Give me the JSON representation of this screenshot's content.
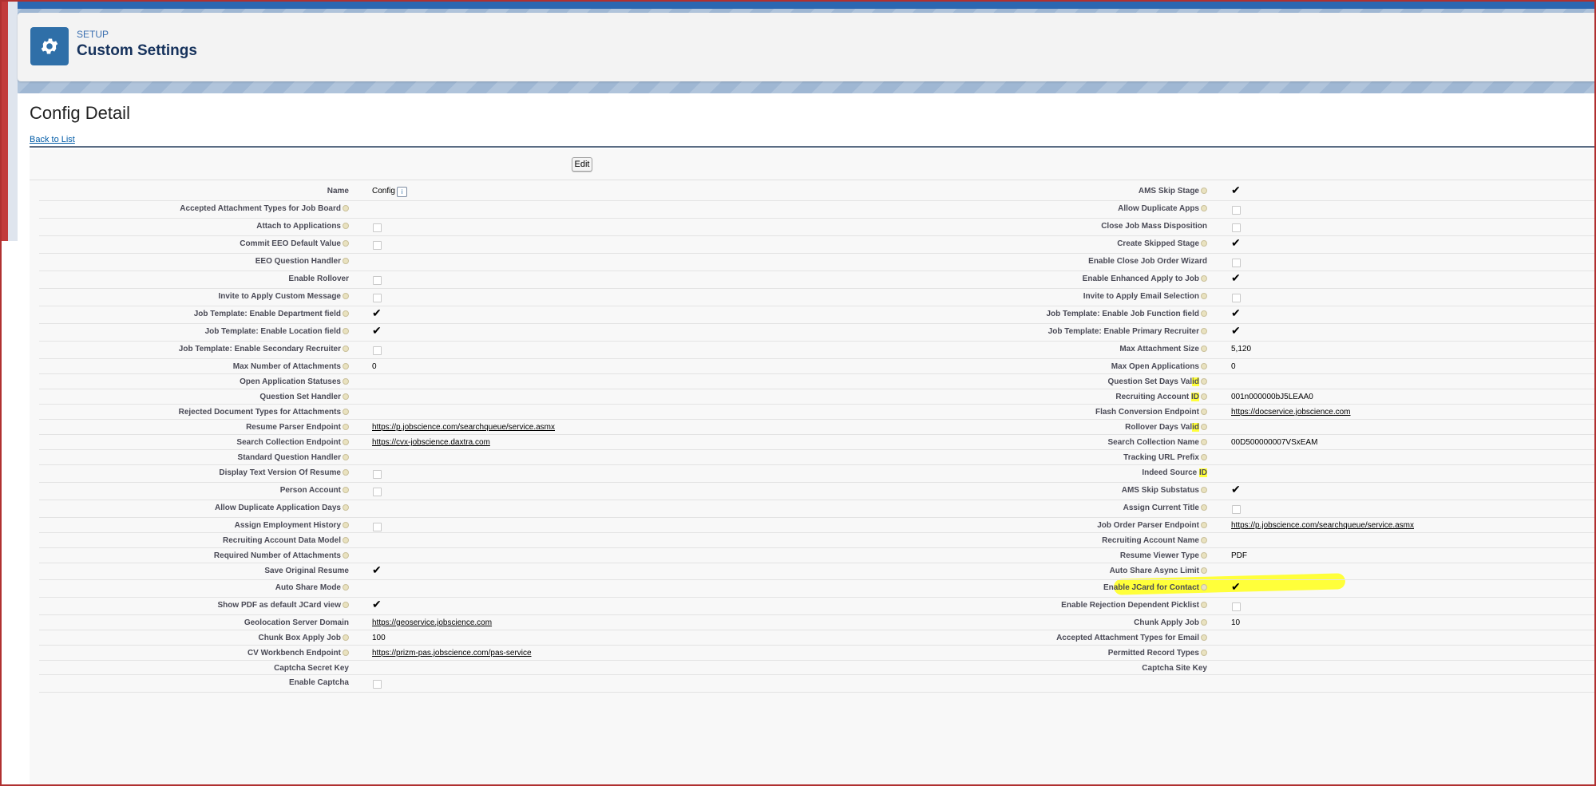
{
  "header": {
    "eyebrow": "SETUP",
    "title": "Custom Settings",
    "icon": "gear-icon"
  },
  "main": {
    "title": "Config Detail",
    "back_link": "Back to List",
    "edit_label": "Edit"
  },
  "colors": {
    "header_bar": "#2b67b1",
    "icon_bg": "#2f6fa8",
    "highlight": "#ffff3a"
  },
  "rows": [
    {
      "left": {
        "label": "Name",
        "type": "text",
        "value": "Config",
        "info": true,
        "help": false
      },
      "right": {
        "label": "AMS Skip Stage",
        "type": "check",
        "checked": true
      }
    },
    {
      "left": {
        "label": "Accepted Attachment Types for Job Board",
        "type": "text",
        "value": ""
      },
      "right": {
        "label": "Allow Duplicate Apps",
        "type": "check",
        "checked": false
      }
    },
    {
      "left": {
        "label": "Attach to Applications",
        "type": "check",
        "checked": false
      },
      "right": {
        "label": "Close Job Mass Disposition",
        "type": "check",
        "checked": false,
        "help": false
      }
    },
    {
      "left": {
        "label": "Commit EEO Default Value",
        "type": "check",
        "checked": false
      },
      "right": {
        "label": "Create Skipped Stage",
        "type": "check",
        "checked": true
      }
    },
    {
      "left": {
        "label": "EEO Question Handler",
        "type": "text",
        "value": ""
      },
      "right": {
        "label": "Enable Close Job Order Wizard",
        "type": "check",
        "checked": false,
        "help": false
      }
    },
    {
      "left": {
        "label": "Enable Rollover",
        "type": "check",
        "checked": false,
        "help": false
      },
      "right": {
        "label": "Enable Enhanced Apply to Job",
        "type": "check",
        "checked": true
      }
    },
    {
      "left": {
        "label": "Invite to Apply Custom Message",
        "type": "check",
        "checked": false
      },
      "right": {
        "label": "Invite to Apply Email Selection",
        "type": "check",
        "checked": false
      }
    },
    {
      "left": {
        "label": "Job Template: Enable Department field",
        "type": "check",
        "checked": true
      },
      "right": {
        "label": "Job Template: Enable Job Function field",
        "type": "check",
        "checked": true
      }
    },
    {
      "left": {
        "label": "Job Template: Enable Location field",
        "type": "check",
        "checked": true
      },
      "right": {
        "label": "Job Template: Enable Primary Recruiter",
        "type": "check",
        "checked": true
      }
    },
    {
      "left": {
        "label": "Job Template: Enable Secondary Recruiter",
        "type": "check",
        "checked": false
      },
      "right": {
        "label": "Max Attachment Size",
        "type": "text",
        "value": "5,120"
      }
    },
    {
      "left": {
        "label": "Max Number of Attachments",
        "type": "text",
        "value": "0"
      },
      "right": {
        "label": "Max Open Applications",
        "type": "text",
        "value": "0"
      }
    },
    {
      "left": {
        "label": "Open Application Statuses",
        "type": "text",
        "value": ""
      },
      "right": {
        "label": "Question Set Days Val",
        "label_hl": "id",
        "type": "text",
        "value": ""
      }
    },
    {
      "left": {
        "label": "Question Set Handler",
        "type": "text",
        "value": ""
      },
      "right": {
        "label": "Recruiting Account ",
        "label_hl": "ID",
        "type": "text",
        "value": "001n000000bJ5LEAA0",
        "highlight": true
      }
    },
    {
      "left": {
        "label": "Rejected Document Types for Attachments",
        "type": "text",
        "value": ""
      },
      "right": {
        "label": "Flash Conversion Endpoint",
        "type": "link",
        "value": "https://docservice.jobscience.com"
      }
    },
    {
      "left": {
        "label": "Resume Parser Endpoint",
        "type": "link",
        "value": "https://p.jobscience.com/searchqueue/service.asmx"
      },
      "right": {
        "label": "Rollover Days Val",
        "label_hl": "id",
        "type": "text",
        "value": ""
      }
    },
    {
      "left": {
        "label": "Search Collection Endpoint",
        "type": "link",
        "value": "https://cvx-jobscience.daxtra.com"
      },
      "right": {
        "label": "Search Collection Name",
        "type": "text",
        "value": "00D500000007VSxEAM"
      }
    },
    {
      "left": {
        "label": "Standard Question Handler",
        "type": "text",
        "value": ""
      },
      "right": {
        "label": "Tracking URL Prefix",
        "type": "text",
        "value": ""
      }
    },
    {
      "left": {
        "label": "Display Text Version Of Resume",
        "type": "check",
        "checked": false
      },
      "right": {
        "label": "Indeed Source ",
        "label_hl": "ID",
        "type": "text",
        "value": "",
        "help": false
      }
    },
    {
      "left": {
        "label": "Person Account",
        "type": "check",
        "checked": false
      },
      "right": {
        "label": "AMS Skip Substatus",
        "type": "check",
        "checked": true
      }
    },
    {
      "left": {
        "label": "Allow Duplicate Application Days",
        "type": "text",
        "value": ""
      },
      "right": {
        "label": "Assign Current Title",
        "type": "check",
        "checked": false
      }
    },
    {
      "left": {
        "label": "Assign Employment History",
        "type": "check",
        "checked": false
      },
      "right": {
        "label": "Job Order Parser Endpoint",
        "type": "link",
        "value": "https://p.jobscience.com/searchqueue/service.asmx"
      }
    },
    {
      "left": {
        "label": "Recruiting Account Data Model",
        "type": "text",
        "value": ""
      },
      "right": {
        "label": "Recruiting Account Name",
        "type": "text",
        "value": ""
      }
    },
    {
      "left": {
        "label": "Required Number of Attachments",
        "type": "text",
        "value": ""
      },
      "right": {
        "label": "Resume Viewer Type",
        "type": "text",
        "value": "PDF"
      }
    },
    {
      "left": {
        "label": "Save Original Resume",
        "type": "check",
        "checked": true,
        "help": false
      },
      "right": {
        "label": "Auto Share Async Limit",
        "type": "text",
        "value": ""
      }
    },
    {
      "left": {
        "label": "Auto Share Mode",
        "type": "text",
        "value": ""
      },
      "right": {
        "label": "Enable JCard for Contact",
        "type": "check",
        "checked": true
      }
    },
    {
      "left": {
        "label": "Show PDF as default JCard view",
        "type": "check",
        "checked": true
      },
      "right": {
        "label": "Enable Rejection Dependent Picklist",
        "type": "check",
        "checked": false
      }
    },
    {
      "left": {
        "label": "Geolocation Server Domain",
        "type": "link",
        "value": "https://geoservice.jobscience.com",
        "help": false
      },
      "right": {
        "label": "Chunk Apply Job",
        "type": "text",
        "value": "10"
      }
    },
    {
      "left": {
        "label": "Chunk Box Apply Job",
        "type": "text",
        "value": "100"
      },
      "right": {
        "label": "Accepted Attachment Types for Email",
        "type": "text",
        "value": ""
      }
    },
    {
      "left": {
        "label": "CV Workbench Endpoint",
        "type": "link",
        "value": "https://prizm-pas.jobscience.com/pas-service"
      },
      "right": {
        "label": "Permitted Record Types",
        "type": "text",
        "value": ""
      }
    },
    {
      "left": {
        "label": "Captcha Secret Key",
        "type": "text",
        "value": "",
        "help": false
      },
      "right": {
        "label": "Captcha Site Key",
        "type": "text",
        "value": "",
        "help": false
      }
    },
    {
      "left": {
        "label": "Enable Captcha",
        "type": "check",
        "checked": false,
        "help": false
      },
      "right": null
    }
  ]
}
